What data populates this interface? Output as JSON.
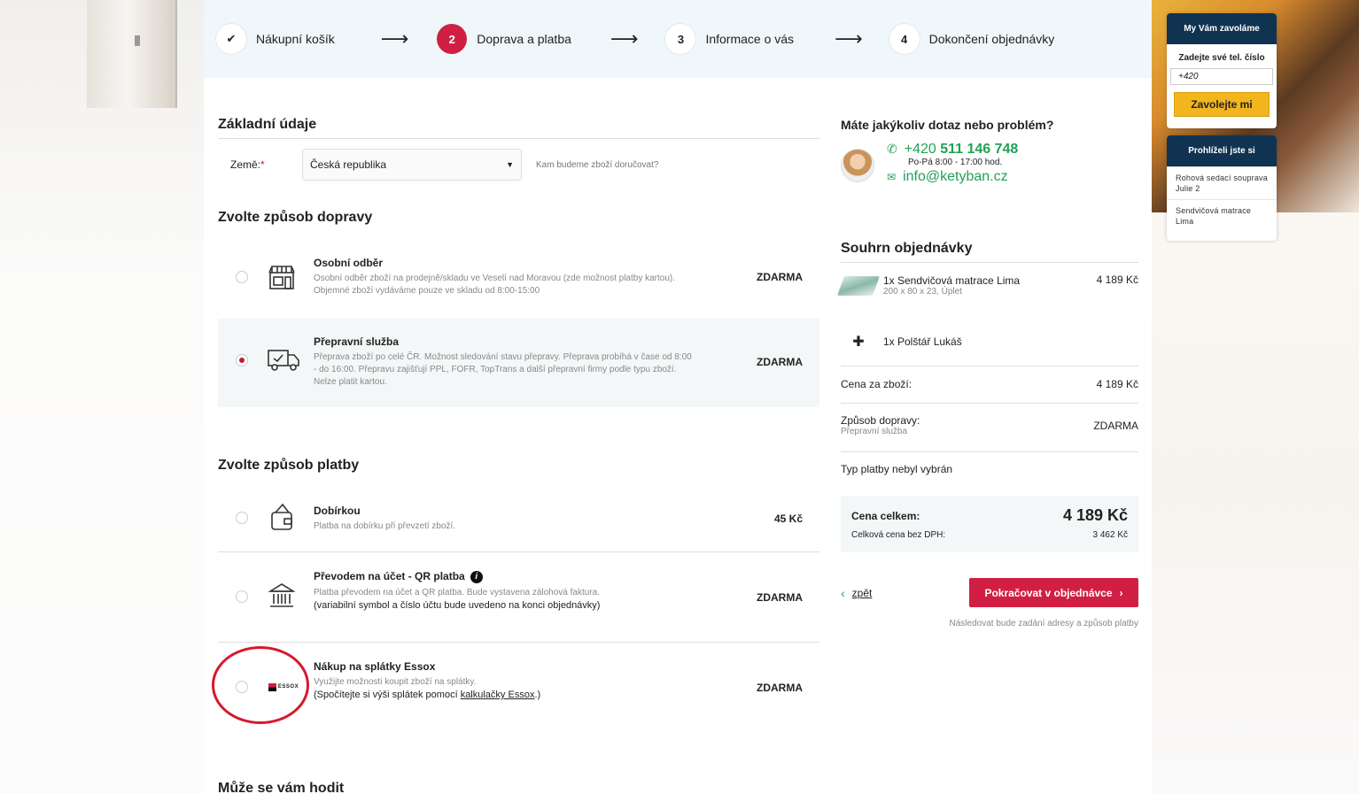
{
  "steps": [
    {
      "num": "✔",
      "label": "Nákupní košík"
    },
    {
      "num": "2",
      "label": "Doprava a platba"
    },
    {
      "num": "3",
      "label": "Informace o vás"
    },
    {
      "num": "4",
      "label": "Dokončení objednávky"
    }
  ],
  "arrow": "⟶",
  "basic": {
    "title": "Základní údaje",
    "country_label": "Země:",
    "required": "*",
    "country_value": "Česká republika",
    "country_hint": "Kam budeme zboží doručovat?"
  },
  "shipping": {
    "title": "Zvolte způsob dopravy",
    "options": [
      {
        "title": "Osobní odběr",
        "desc": "Osobní odběr zboží na prodejně/skladu ve Veselí nad Moravou (zde možnost platby kartou). Objemné zboží vydáváme pouze ve skladu od 8:00-15:00",
        "price": "ZDARMA",
        "selected": false,
        "icon": "store-icon"
      },
      {
        "title": "Přepravní služba",
        "desc": "Přeprava zboží po celé ČR. Možnost sledování stavu přepravy. Přeprava probíhá v čase od 8:00 - do 16:00. Přepravu zajišťují PPL, FOFR, TopTrans a další přepravní firmy podle typu zboží. Nelze platit kartou.",
        "price": "ZDARMA",
        "selected": true,
        "icon": "truck-icon"
      }
    ]
  },
  "payment": {
    "title": "Zvolte způsob platby",
    "options": [
      {
        "title": "Dobírkou",
        "desc": "Platba na dobírku při převzetí zboží.",
        "price": "45 Kč",
        "icon": "wallet-icon"
      },
      {
        "title": "Převodem na účet - QR platba",
        "info": "i",
        "desc": "Platba převodem na účet a QR platba. Bude vystavena zálohová faktura.",
        "desc2": "(variabilní symbol a číslo účtu bude uvedeno na konci objednávky)",
        "price": "ZDARMA",
        "icon": "bank-icon"
      },
      {
        "title": "Nákup na splátky Essox",
        "desc": "Využijte možnosti koupit zboží na splátky.",
        "desc2_pre": "(Spočítejte si výši splátek pomocí ",
        "desc2_link": "kalkulačky Essox",
        "desc2_post": ".)",
        "price": "ZDARMA",
        "icon": "essox-logo",
        "logo_text": "ESSOX"
      }
    ]
  },
  "more": {
    "title": "Může se vám hodit"
  },
  "contact": {
    "title": "Máte jakýkoliv dotaz nebo problém?",
    "phone_prefix": "+420 ",
    "phone_number": "511 146 748",
    "hours": "Po-Pá 8:00 - 17:00 hod.",
    "email": "info@ketyban.cz"
  },
  "summary": {
    "title": "Souhrn objednávky",
    "items": [
      {
        "name": "1x Sendvičová matrace Lima",
        "variant": "200 x 80 x 23, Úplet",
        "price": "4 189 Kč"
      },
      {
        "name": "1x Polštář Lukáš",
        "plus": "✚"
      }
    ],
    "goods_label": "Cena za zboží:",
    "goods_value": "4 189 Kč",
    "shipping_label": "Způsob dopravy:",
    "shipping_sub": "Přepravní služba",
    "shipping_value": "ZDARMA",
    "payment_status": "Typ platby nebyl vybrán",
    "total_label": "Cena celkem:",
    "total_value": "4 189 Kč",
    "net_label": "Celková cena bez DPH:",
    "net_value": "3 462 Kč",
    "back": "zpět",
    "back_icon": "‹",
    "continue": "Pokračovat v objednávce",
    "continue_icon": "›",
    "next_hint": "Následovat bude zadání adresy a způsob platby"
  },
  "callback": {
    "title": "My Vám zavoláme",
    "prompt": "Zadejte své tel. číslo",
    "phone_value": "+420",
    "button": "Zavolejte mi"
  },
  "viewed": {
    "title": "Prohlíželi jste si",
    "items": [
      "Rohová sedací souprava Julie 2",
      "Sendvičová matrace Lima"
    ]
  },
  "colors": {
    "accent": "#d11f44",
    "green": "#22a155",
    "navy": "#0f3350",
    "yellow": "#f2b51d"
  }
}
